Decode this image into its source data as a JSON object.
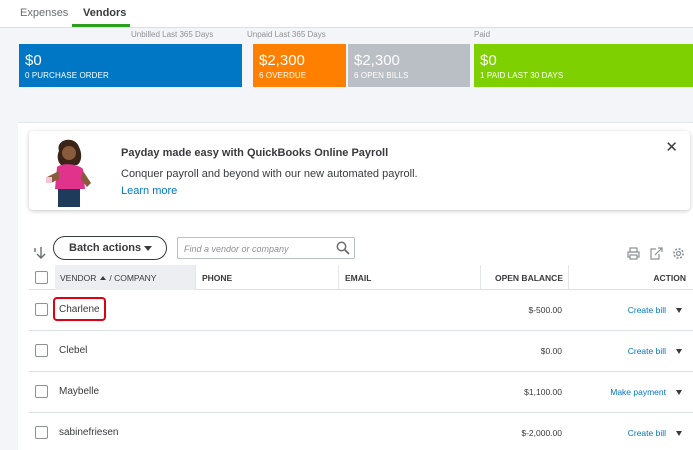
{
  "tabs": [
    {
      "label": "Expenses",
      "active": false
    },
    {
      "label": "Vendors",
      "active": true
    }
  ],
  "money_bar": {
    "unbilled_label": "Unbilled Last 365 Days",
    "unpaid_label": "Unpaid Last 365 Days",
    "paid_label": "Paid",
    "blocks": [
      {
        "amount": "$0",
        "sub": "0 PURCHASE ORDER",
        "color": "#0077c5"
      },
      {
        "amount": "$2,300",
        "sub": "6 OVERDUE",
        "color": "#ff8000"
      },
      {
        "amount": "$2,300",
        "sub": "6 OPEN BILLS",
        "color": "#babec5"
      },
      {
        "amount": "$0",
        "sub": "1 PAID LAST 30 DAYS",
        "color": "#7fd000"
      }
    ]
  },
  "banner": {
    "title": "Payday made easy with QuickBooks Online Payroll",
    "text": "Conquer payroll and beyond with our new automated payroll.",
    "link": "Learn more",
    "close": "✕"
  },
  "toolbar": {
    "batch_actions_label": "Batch actions",
    "search_placeholder": "Find a vendor or company"
  },
  "table": {
    "columns": {
      "vendor": "VENDOR",
      "company": "/ COMPANY",
      "phone": "PHONE",
      "email": "EMAIL",
      "open_balance": "OPEN BALANCE",
      "action": "ACTION"
    },
    "rows": [
      {
        "name": "Charlene",
        "phone": "",
        "email": "",
        "open_balance": "$-500.00",
        "action": "Create bill"
      },
      {
        "name": "Clebel",
        "phone": "",
        "email": "",
        "open_balance": "$0.00",
        "action": "Create bill"
      },
      {
        "name": "Maybelle",
        "phone": "",
        "email": "",
        "open_balance": "$1,100.00",
        "action": "Make payment"
      },
      {
        "name": "sabinefriesen",
        "phone": "",
        "email": "",
        "open_balance": "$-2,000.00",
        "action": "Create bill"
      }
    ]
  },
  "colors": {
    "accent_green": "#2ca01c",
    "link_blue": "#0077c5",
    "highlight_red": "#e1000f"
  }
}
